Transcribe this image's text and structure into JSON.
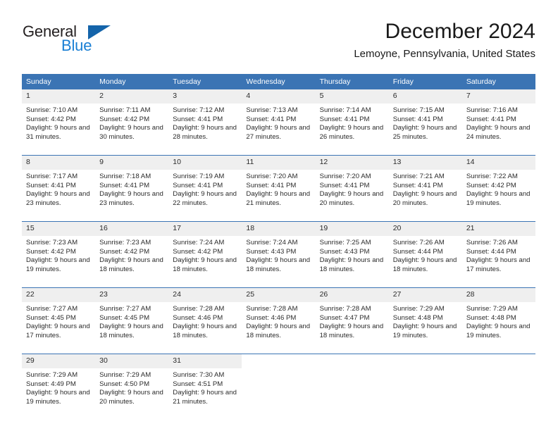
{
  "brand": {
    "name_part1": "General",
    "name_part2": "Blue",
    "triangle_icon": "blue-triangle-icon",
    "colors": {
      "dark": "#231f20",
      "blue": "#1a7fd4",
      "triangle": "#1464aa"
    }
  },
  "header": {
    "month_title": "December 2024",
    "location": "Lemoyne, Pennsylvania, United States"
  },
  "theme": {
    "header_blue": "#3b74b4",
    "day_band_gray": "#efefef",
    "text": "#2b2b2b"
  },
  "calendar": {
    "weekday_headers": [
      "Sunday",
      "Monday",
      "Tuesday",
      "Wednesday",
      "Thursday",
      "Friday",
      "Saturday"
    ],
    "weeks": [
      [
        {
          "day": "1",
          "sunrise": "Sunrise: 7:10 AM",
          "sunset": "Sunset: 4:42 PM",
          "daylight": "Daylight: 9 hours and 31 minutes."
        },
        {
          "day": "2",
          "sunrise": "Sunrise: 7:11 AM",
          "sunset": "Sunset: 4:42 PM",
          "daylight": "Daylight: 9 hours and 30 minutes."
        },
        {
          "day": "3",
          "sunrise": "Sunrise: 7:12 AM",
          "sunset": "Sunset: 4:41 PM",
          "daylight": "Daylight: 9 hours and 28 minutes."
        },
        {
          "day": "4",
          "sunrise": "Sunrise: 7:13 AM",
          "sunset": "Sunset: 4:41 PM",
          "daylight": "Daylight: 9 hours and 27 minutes."
        },
        {
          "day": "5",
          "sunrise": "Sunrise: 7:14 AM",
          "sunset": "Sunset: 4:41 PM",
          "daylight": "Daylight: 9 hours and 26 minutes."
        },
        {
          "day": "6",
          "sunrise": "Sunrise: 7:15 AM",
          "sunset": "Sunset: 4:41 PM",
          "daylight": "Daylight: 9 hours and 25 minutes."
        },
        {
          "day": "7",
          "sunrise": "Sunrise: 7:16 AM",
          "sunset": "Sunset: 4:41 PM",
          "daylight": "Daylight: 9 hours and 24 minutes."
        }
      ],
      [
        {
          "day": "8",
          "sunrise": "Sunrise: 7:17 AM",
          "sunset": "Sunset: 4:41 PM",
          "daylight": "Daylight: 9 hours and 23 minutes."
        },
        {
          "day": "9",
          "sunrise": "Sunrise: 7:18 AM",
          "sunset": "Sunset: 4:41 PM",
          "daylight": "Daylight: 9 hours and 23 minutes."
        },
        {
          "day": "10",
          "sunrise": "Sunrise: 7:19 AM",
          "sunset": "Sunset: 4:41 PM",
          "daylight": "Daylight: 9 hours and 22 minutes."
        },
        {
          "day": "11",
          "sunrise": "Sunrise: 7:20 AM",
          "sunset": "Sunset: 4:41 PM",
          "daylight": "Daylight: 9 hours and 21 minutes."
        },
        {
          "day": "12",
          "sunrise": "Sunrise: 7:20 AM",
          "sunset": "Sunset: 4:41 PM",
          "daylight": "Daylight: 9 hours and 20 minutes."
        },
        {
          "day": "13",
          "sunrise": "Sunrise: 7:21 AM",
          "sunset": "Sunset: 4:41 PM",
          "daylight": "Daylight: 9 hours and 20 minutes."
        },
        {
          "day": "14",
          "sunrise": "Sunrise: 7:22 AM",
          "sunset": "Sunset: 4:42 PM",
          "daylight": "Daylight: 9 hours and 19 minutes."
        }
      ],
      [
        {
          "day": "15",
          "sunrise": "Sunrise: 7:23 AM",
          "sunset": "Sunset: 4:42 PM",
          "daylight": "Daylight: 9 hours and 19 minutes."
        },
        {
          "day": "16",
          "sunrise": "Sunrise: 7:23 AM",
          "sunset": "Sunset: 4:42 PM",
          "daylight": "Daylight: 9 hours and 18 minutes."
        },
        {
          "day": "17",
          "sunrise": "Sunrise: 7:24 AM",
          "sunset": "Sunset: 4:42 PM",
          "daylight": "Daylight: 9 hours and 18 minutes."
        },
        {
          "day": "18",
          "sunrise": "Sunrise: 7:24 AM",
          "sunset": "Sunset: 4:43 PM",
          "daylight": "Daylight: 9 hours and 18 minutes."
        },
        {
          "day": "19",
          "sunrise": "Sunrise: 7:25 AM",
          "sunset": "Sunset: 4:43 PM",
          "daylight": "Daylight: 9 hours and 18 minutes."
        },
        {
          "day": "20",
          "sunrise": "Sunrise: 7:26 AM",
          "sunset": "Sunset: 4:44 PM",
          "daylight": "Daylight: 9 hours and 18 minutes."
        },
        {
          "day": "21",
          "sunrise": "Sunrise: 7:26 AM",
          "sunset": "Sunset: 4:44 PM",
          "daylight": "Daylight: 9 hours and 17 minutes."
        }
      ],
      [
        {
          "day": "22",
          "sunrise": "Sunrise: 7:27 AM",
          "sunset": "Sunset: 4:45 PM",
          "daylight": "Daylight: 9 hours and 17 minutes."
        },
        {
          "day": "23",
          "sunrise": "Sunrise: 7:27 AM",
          "sunset": "Sunset: 4:45 PM",
          "daylight": "Daylight: 9 hours and 18 minutes."
        },
        {
          "day": "24",
          "sunrise": "Sunrise: 7:28 AM",
          "sunset": "Sunset: 4:46 PM",
          "daylight": "Daylight: 9 hours and 18 minutes."
        },
        {
          "day": "25",
          "sunrise": "Sunrise: 7:28 AM",
          "sunset": "Sunset: 4:46 PM",
          "daylight": "Daylight: 9 hours and 18 minutes."
        },
        {
          "day": "26",
          "sunrise": "Sunrise: 7:28 AM",
          "sunset": "Sunset: 4:47 PM",
          "daylight": "Daylight: 9 hours and 18 minutes."
        },
        {
          "day": "27",
          "sunrise": "Sunrise: 7:29 AM",
          "sunset": "Sunset: 4:48 PM",
          "daylight": "Daylight: 9 hours and 19 minutes."
        },
        {
          "day": "28",
          "sunrise": "Sunrise: 7:29 AM",
          "sunset": "Sunset: 4:48 PM",
          "daylight": "Daylight: 9 hours and 19 minutes."
        }
      ],
      [
        {
          "day": "29",
          "sunrise": "Sunrise: 7:29 AM",
          "sunset": "Sunset: 4:49 PM",
          "daylight": "Daylight: 9 hours and 19 minutes."
        },
        {
          "day": "30",
          "sunrise": "Sunrise: 7:29 AM",
          "sunset": "Sunset: 4:50 PM",
          "daylight": "Daylight: 9 hours and 20 minutes."
        },
        {
          "day": "31",
          "sunrise": "Sunrise: 7:30 AM",
          "sunset": "Sunset: 4:51 PM",
          "daylight": "Daylight: 9 hours and 21 minutes."
        },
        {
          "day": "",
          "sunrise": "",
          "sunset": "",
          "daylight": ""
        },
        {
          "day": "",
          "sunrise": "",
          "sunset": "",
          "daylight": ""
        },
        {
          "day": "",
          "sunrise": "",
          "sunset": "",
          "daylight": ""
        },
        {
          "day": "",
          "sunrise": "",
          "sunset": "",
          "daylight": ""
        }
      ]
    ]
  }
}
